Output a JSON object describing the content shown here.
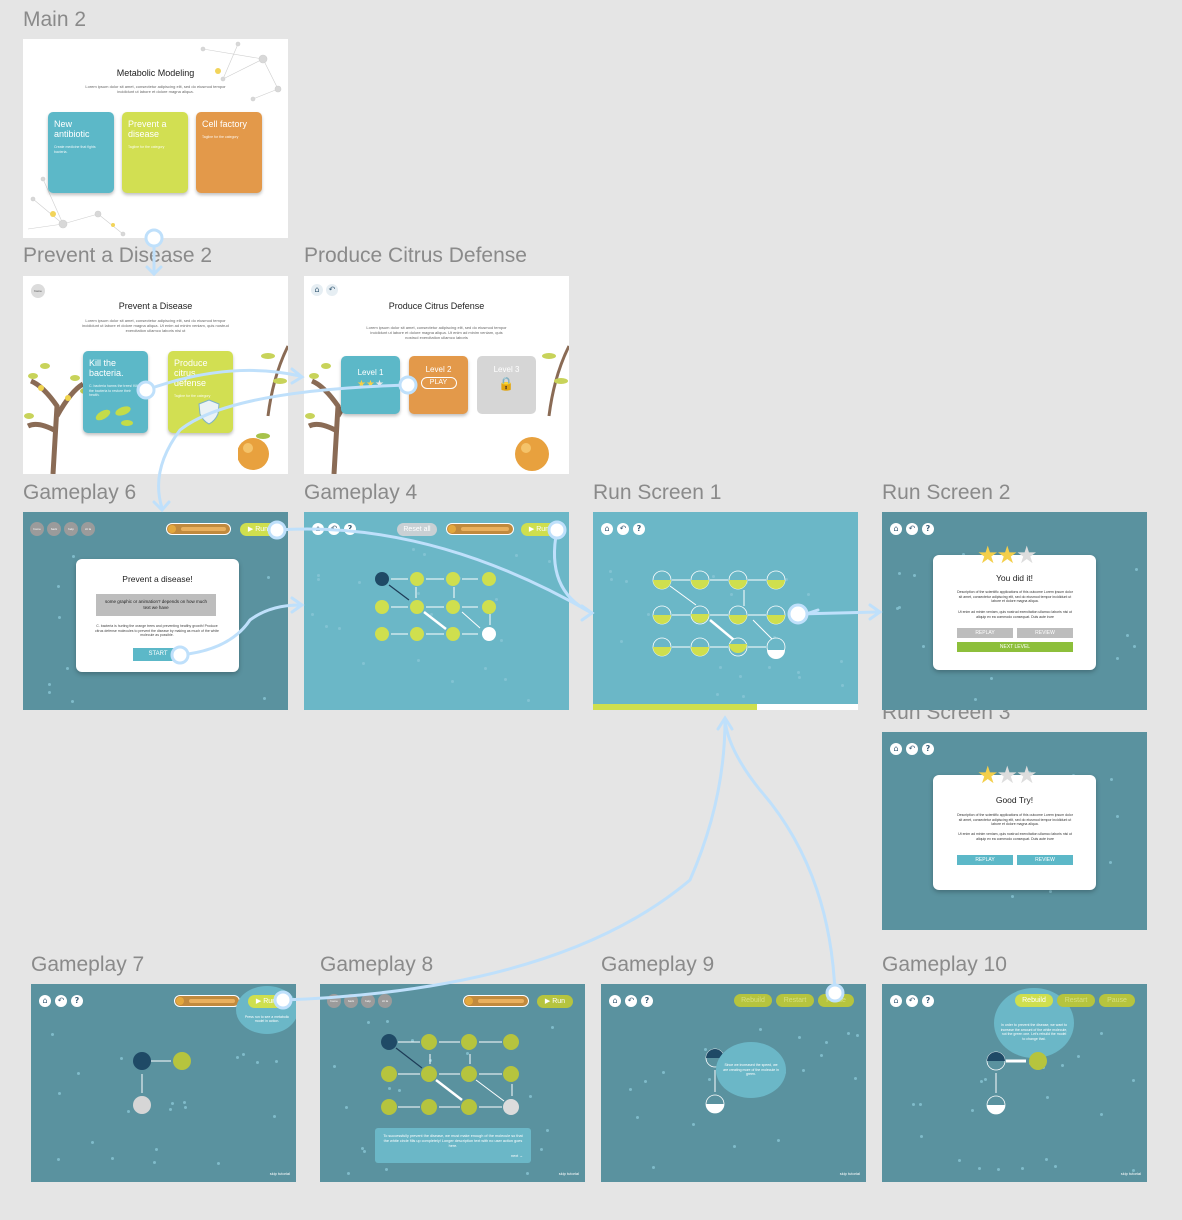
{
  "colors": {
    "canvas": "#e5e5e5",
    "teal": "#5a929f",
    "teal_light": "#6bb7c7",
    "lime": "#cfdf4e",
    "orange": "#e3994a",
    "blue_card": "#5cb8c8",
    "proto_link": "#bfe0fb",
    "star_gold": "#f4cf4a",
    "star_gray": "#dddddd",
    "button_green": "#8dbf3b"
  },
  "frames": {
    "main2": {
      "label": "Main 2",
      "title": "Metabolic Modeling",
      "intro": "Lorem ipsum dolor sit amet, consectetur adipiscing elit, sed do eiusmod tempor incididunt ut labore et dolore magna aliqua.",
      "cards": [
        {
          "title": "New antibiotic",
          "desc": "Create medicine that fights bacteria.",
          "color": "#5cb8c8"
        },
        {
          "title": "Prevent a disease",
          "desc": "Tagline for the category",
          "color": "#d2df52"
        },
        {
          "title": "Cell factory",
          "desc": "Tagline for the category",
          "color": "#e3994a"
        }
      ]
    },
    "prevent2": {
      "label": "Prevent a Disease 2",
      "home": "home",
      "title": "Prevent a Disease",
      "intro": "Lorem ipsum dolor sit amet, consectetur adipiscing elit, sed do eiusmod tempor incididunt ut labore et dolore magna aliqua. Ut enim ad minim veniam, quis nostrud exercitation ullamco laboris nisi ut",
      "cards": [
        {
          "title": "Kill the bacteria.",
          "desc": "C. bacteria harms the trees! Kill the bacteria to restore their health."
        },
        {
          "title": "Produce citrus defense",
          "desc": "Tagline for the category"
        }
      ]
    },
    "citrus": {
      "label": "Produce Citrus Defense",
      "title": "Produce Citrus Defense",
      "intro": "Lorem ipsum dolor sit amet, consectetur adipiscing elit, sed do eiusmod tempor incididunt ut labore et dolore magna aliqua. Ut enim ad minim veniam, quis nostrud exercitation ullamco laboris",
      "level1": "Level 1",
      "level2": "Level 2",
      "level3": "Level 3",
      "play": "PLAY",
      "level1_stars": 2
    },
    "gp6": {
      "label": "Gameplay 6",
      "nav": [
        "home",
        "back",
        "help",
        "cit la"
      ],
      "run": "Run",
      "modal_title": "Prevent a disease!",
      "placeholder": "some graphic or animation? depends on how much text we have",
      "body": "C. bacteria is hurting the orange trees and preventing healthy growth! Produce citrus defense molecules to prevent the disease by making as much of the white molecule as possible.",
      "start": "START"
    },
    "gp4": {
      "label": "Gameplay 4",
      "reset": "Reset all",
      "run": "Run"
    },
    "run1": {
      "label": "Run Screen 1",
      "progress": 0.62
    },
    "run2": {
      "label": "Run Screen 2",
      "title": "You did it!",
      "desc1": "Description of the scientific applications of this outcome Lorem ipsum dolor sit amet, consectetur adipiscing elit, sed do eiusmod tempor incididunt ut labore et dolore magna aliqua.",
      "desc2": "Ut enim ad minim veniam, quis nostrud exercitation ullamco laboris nisi ut aliquip ex ea commodo consequat. Duis aute irure",
      "replay": "REPLAY",
      "review": "REVIEW",
      "next": "NEXT LEVEL",
      "stars": 2
    },
    "run3": {
      "label": "Run Screen 3",
      "title": "Good Try!",
      "desc1": "Description of the scientific applications of this outcome Lorem ipsum dolor sit amet, consectetur adipiscing elit, sed do eiusmod tempor incididunt ut labore et dolore magna aliqua.",
      "desc2": "Ut enim ad minim veniam, quis nostrud exercitation ullamco laboris nisi ut aliquip ex ea commodo consequat. Duis aute irure",
      "replay": "REPLAY",
      "review": "REVIEW",
      "stars": 1
    },
    "gp7": {
      "label": "Gameplay 7",
      "run": "Run",
      "tip": "Press run to see a metabolic model in action.",
      "skip": "skip tutorial"
    },
    "gp8": {
      "label": "Gameplay 8",
      "nav": [
        "home",
        "back",
        "help",
        "cit la"
      ],
      "run": "Run",
      "text": "To successfully prevent the disease, we must make enough of the molecule so that the white circle fills up completely! Longer description text with no user action goes here.",
      "next": "next →",
      "skip": "skip tutorial"
    },
    "gp9": {
      "label": "Gameplay 9",
      "rebuild": "Rebuild",
      "restart": "Restart",
      "pause": "Pause",
      "tip": "Since we increased the speed, we are creating more of the molecule in green.",
      "skip": "skip tutorial"
    },
    "gp10": {
      "label": "Gameplay 10",
      "rebuild": "Rebuild",
      "restart": "Restart",
      "pause": "Pause",
      "tip": "In order to prevent the disease, we want to increase the amount of the white molecule, not the green one. Let's rebuild the model to change that.",
      "skip": "skip tutorial"
    }
  }
}
